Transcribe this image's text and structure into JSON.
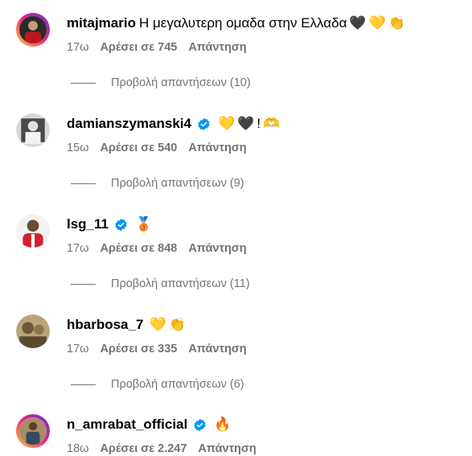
{
  "comments": [
    {
      "username": "mitajmario",
      "text": "Η μεγαλυτερη ομαδα στην Ελλαδα",
      "emojis": [
        "🖤",
        "💛",
        "👏"
      ],
      "verified": false,
      "time": "17ω",
      "likes": "Αρέσει σε 745",
      "reply": "Απάντηση",
      "view_replies": "Προβολή απαντήσεων (10)",
      "avatar_colors": [
        "#2a2a2a",
        "#c0171c"
      ]
    },
    {
      "username": "damianszymanski4",
      "text": "",
      "emojis": [
        "💛",
        "🖤",
        "!",
        "🫶"
      ],
      "verified": true,
      "time": "15ω",
      "likes": "Αρέσει σε 540",
      "reply": "Απάντηση",
      "view_replies": "Προβολή απαντήσεων (9)",
      "avatar_colors": [
        "#d9d9d9",
        "#3a3a3a"
      ]
    },
    {
      "username": "lsg_11",
      "text": "",
      "emojis": [
        "🥉"
      ],
      "verified": true,
      "time": "17ω",
      "likes": "Αρέσει σε 848",
      "reply": "Απάντηση",
      "view_replies": "Προβολή απαντήσεων (11)",
      "avatar_colors": [
        "#f2f2f2",
        "#d0202a"
      ]
    },
    {
      "username": "hbarbosa_7",
      "text": "",
      "emojis": [
        "💛",
        "👏"
      ],
      "verified": false,
      "time": "17ω",
      "likes": "Αρέσει σε 335",
      "reply": "Απάντηση",
      "view_replies": "Προβολή απαντήσεων (6)",
      "avatar_colors": [
        "#6b5a3a",
        "#b8a678"
      ]
    },
    {
      "username": "n_amrabat_official",
      "text": "",
      "emojis": [
        "🔥"
      ],
      "verified": true,
      "time": "18ω",
      "likes": "Αρέσει σε 2.247",
      "reply": "Απάντηση",
      "view_replies": "",
      "avatar_colors": [
        "#a88c6a",
        "#3a4a5a"
      ]
    }
  ],
  "colors": {
    "meta_text": "#737373",
    "verified_blue": "#0095f6"
  }
}
